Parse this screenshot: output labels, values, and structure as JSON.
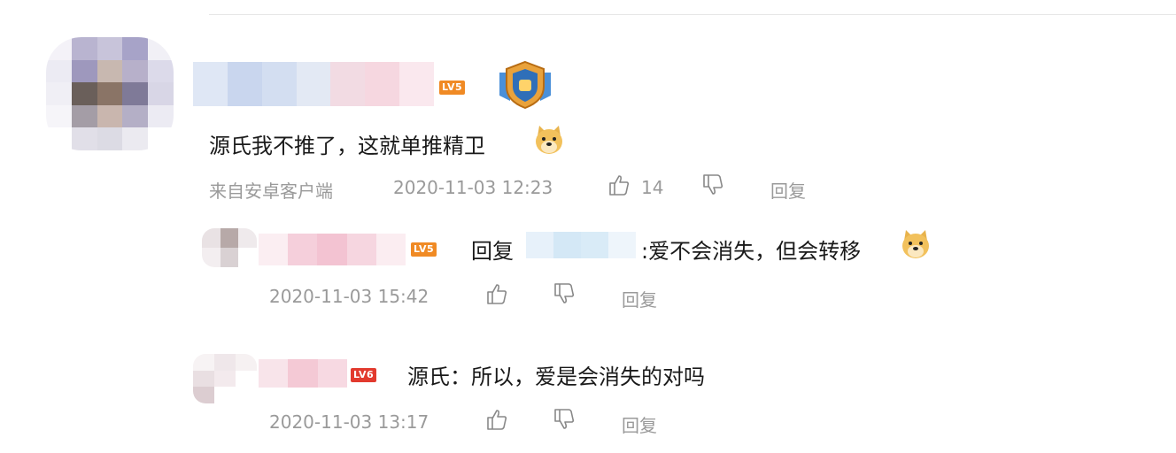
{
  "comment": {
    "level_badge": "LV5",
    "text": "源氏我不推了，这就单推精卫",
    "source": "来自安卓客户端",
    "timestamp": "2020-11-03 12:23",
    "like_count": "14",
    "reply_label": "回复"
  },
  "replies": [
    {
      "level_badge": "LV5",
      "reply_prefix": "回复",
      "text": ":爱不会消失，但会转移",
      "timestamp": "2020-11-03 15:42",
      "reply_label": "回复"
    },
    {
      "level_badge": "LV6",
      "text": "源氏：所以，爱是会消失的对吗",
      "timestamp": "2020-11-03 13:17",
      "reply_label": "回复"
    }
  ],
  "icons": {
    "like": "thumbs-up-icon",
    "dislike": "thumbs-down-icon",
    "medal": "shield-medal-icon",
    "emoji": "doge-emoji-icon"
  },
  "colors": {
    "lv5": "#f08a24",
    "lv6": "#e23a2e",
    "meta": "#9a9a9a"
  }
}
